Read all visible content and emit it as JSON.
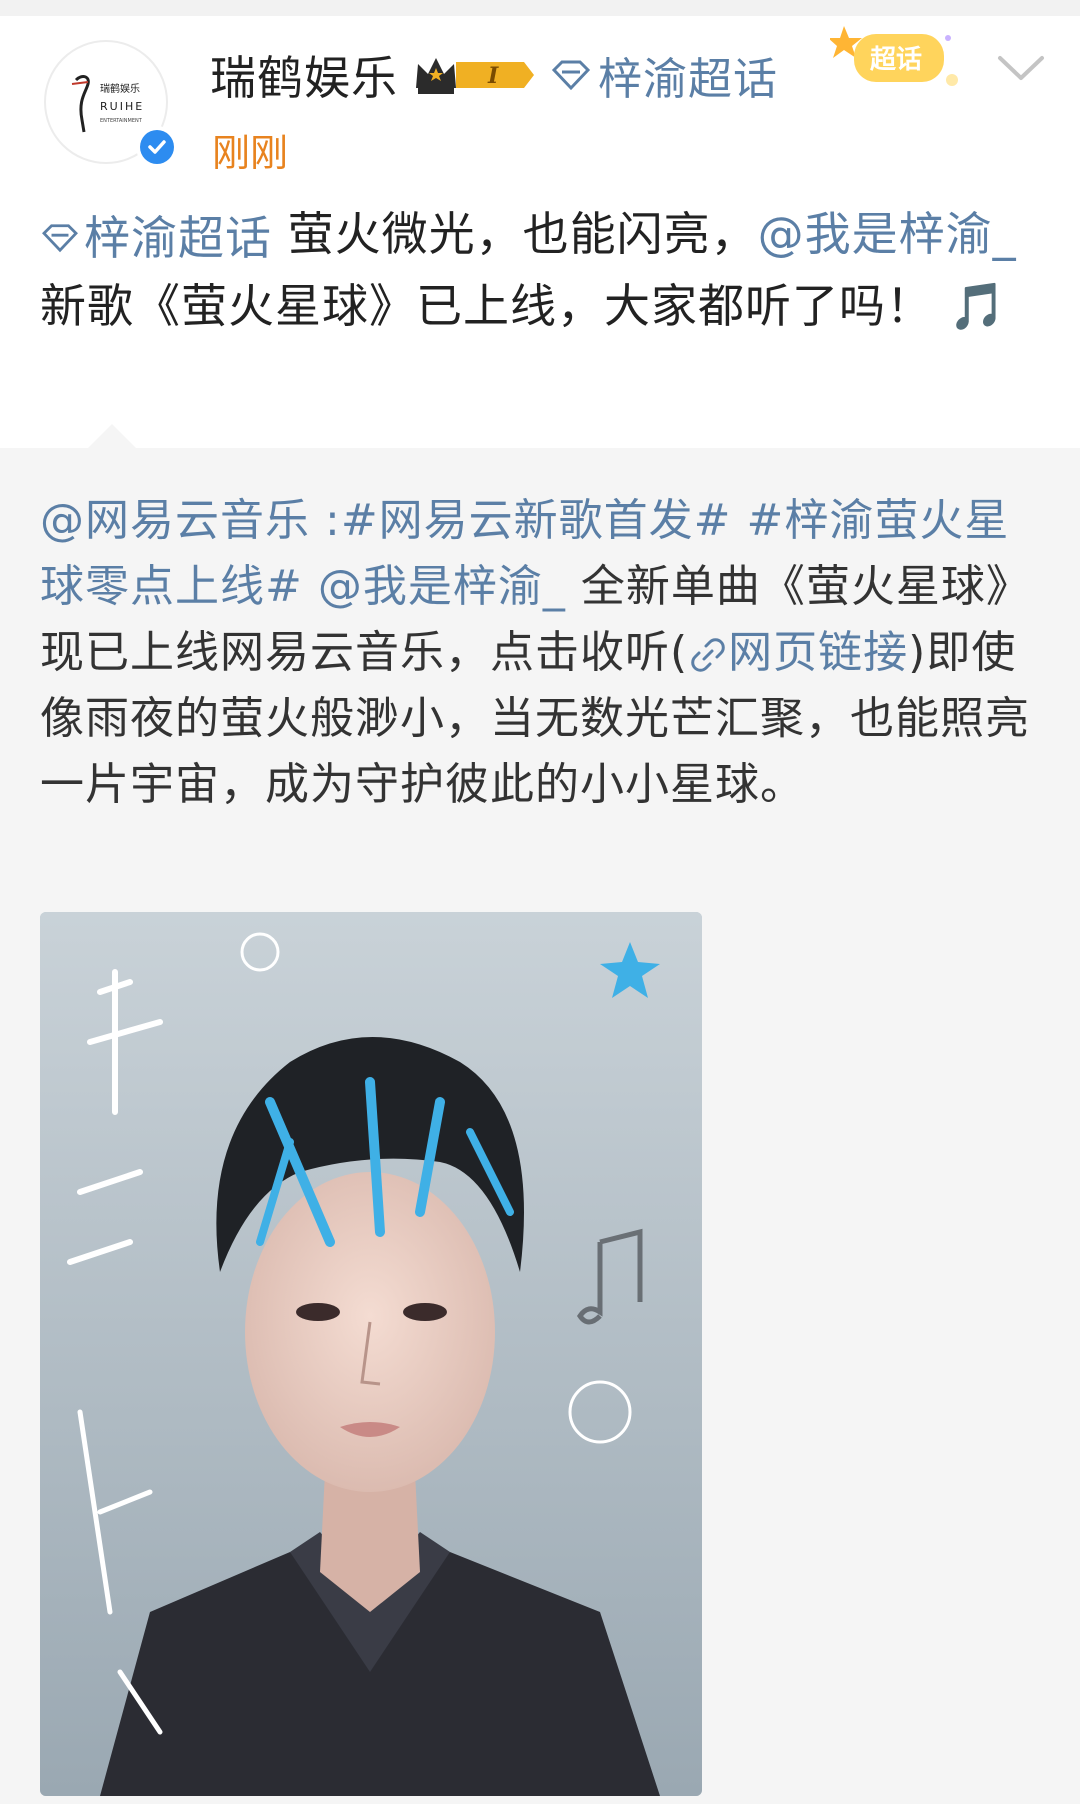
{
  "author": {
    "name": "瑞鹤娱乐",
    "avatar_logo_cn": "瑞鹤娱乐",
    "avatar_logo_en": "RUIHE",
    "avatar_logo_sub": "ENTERTAINMENT",
    "fan_level": "I",
    "topic_chip": "梓渝超话",
    "supertopic_badge": "超话",
    "timestamp": "刚刚"
  },
  "post": {
    "topic_tag": "梓渝超话",
    "text_1": "  萤火微光，也能闪亮，",
    "mention": "@我是梓渝_",
    "text_2": " 新歌《萤火星球》已上线，大家都听了吗！",
    "emoji": "🎵"
  },
  "repost": {
    "mention_source": "@网易云音乐",
    "sep": " :",
    "hashtag_1": "#网易云新歌首发#",
    "hashtag_2": " #梓渝萤火星球零点上线#",
    "mention_artist": " @我是梓渝_",
    "text_1": " 全新单曲《萤火星球》现已上线网易云音乐，点击收听(",
    "link_text": "网页链接",
    "text_2": ")即使像雨夜的萤火般渺小，当无数光芒汇聚，也能照亮一片宇宙，成为守护彼此的小小星球。"
  },
  "colors": {
    "link": "#5b7fa6",
    "timestamp": "#e8831f",
    "verified": "#2d8cf0",
    "repost_bg": "#f5f5f5"
  }
}
